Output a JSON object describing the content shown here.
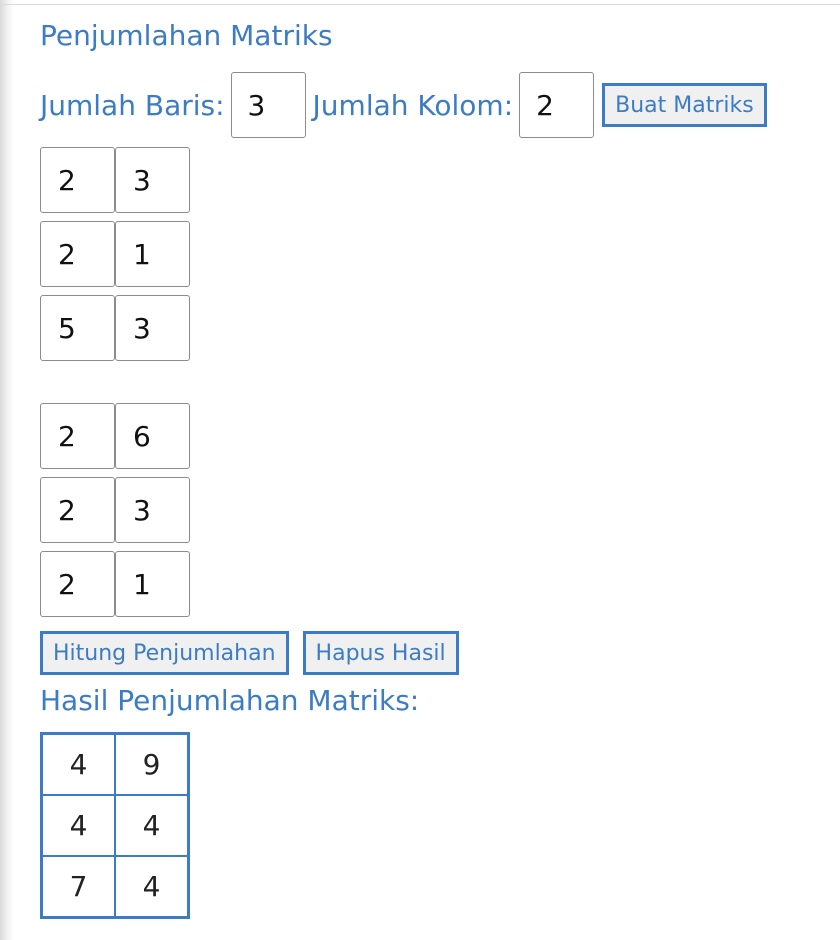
{
  "title": "Penjumlahan Matriks",
  "controls": {
    "rows_label": "Jumlah Baris:",
    "rows_value": "3",
    "cols_label": "Jumlah Kolom:",
    "cols_value": "2",
    "build_button": "Buat Matriks"
  },
  "matrix_a": [
    [
      "2",
      "3"
    ],
    [
      "2",
      "1"
    ],
    [
      "5",
      "3"
    ]
  ],
  "matrix_b": [
    [
      "2",
      "6"
    ],
    [
      "2",
      "3"
    ],
    [
      "2",
      "1"
    ]
  ],
  "actions": {
    "calculate_button": "Hitung Penjumlahan",
    "clear_button": "Hapus Hasil"
  },
  "result": {
    "title": "Hasil Penjumlahan Matriks:",
    "rows": [
      [
        "4",
        "9"
      ],
      [
        "4",
        "4"
      ],
      [
        "7",
        "4"
      ]
    ]
  },
  "colors": {
    "accent": "#3b7cc4",
    "button_bg": "#f0f0f0"
  }
}
